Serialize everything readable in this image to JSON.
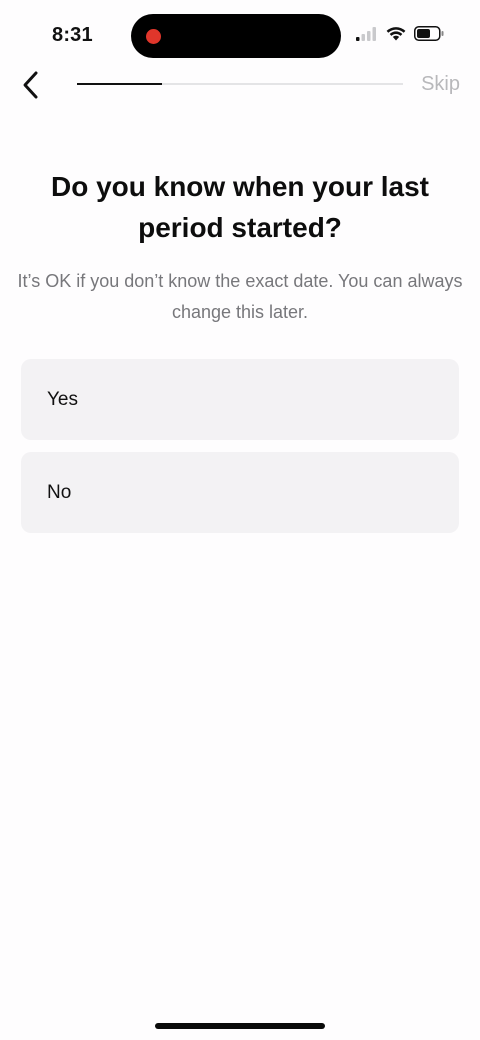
{
  "status_bar": {
    "time": "8:31",
    "icons": [
      "cellular-signal-icon",
      "wifi-icon",
      "battery-icon"
    ],
    "recording_color": "#e0362b"
  },
  "nav": {
    "back_icon": "chevron-left-icon",
    "skip_label": "Skip",
    "progress_fraction": 0.26
  },
  "question": {
    "title": "Do you know when your last period started?",
    "subtitle": "It’s OK if you don’t know the exact date.  You can always change this later."
  },
  "options": [
    {
      "label": "Yes"
    },
    {
      "label": "No"
    }
  ]
}
